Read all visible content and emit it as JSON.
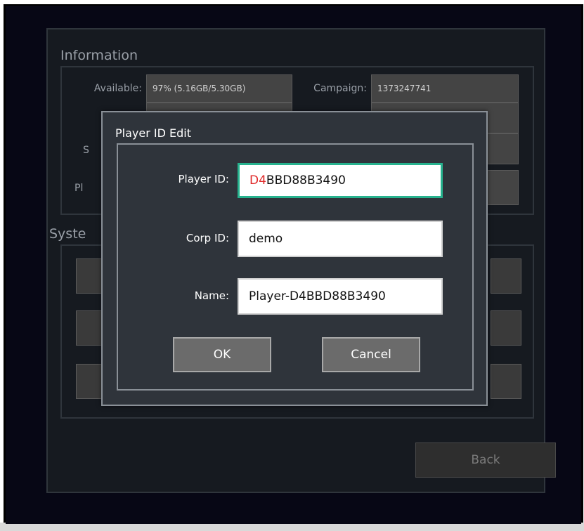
{
  "information": {
    "title": "Information",
    "available_label": "Available:",
    "available_value": "97% (5.16GB/5.30GB)",
    "campaign_label": "Campaign:",
    "campaign_value": "1373247741",
    "partial_label_s": "S",
    "partial_label_pl": "Pl"
  },
  "system": {
    "title": "Syste"
  },
  "back_label": "Back",
  "dialog": {
    "title": "Player ID Edit",
    "player_id_label": "Player ID:",
    "player_id_highlight": "D4",
    "player_id_rest": "BBD88B3490",
    "corp_id_label": "Corp ID:",
    "corp_id_value": "demo",
    "name_label": "Name:",
    "name_value": "Player-D4BBD88B3490",
    "ok_label": "OK",
    "cancel_label": "Cancel"
  },
  "colors": {
    "focus_border": "#27b28e",
    "highlight_text": "#e02a2a",
    "screen_bg": "#070715"
  }
}
